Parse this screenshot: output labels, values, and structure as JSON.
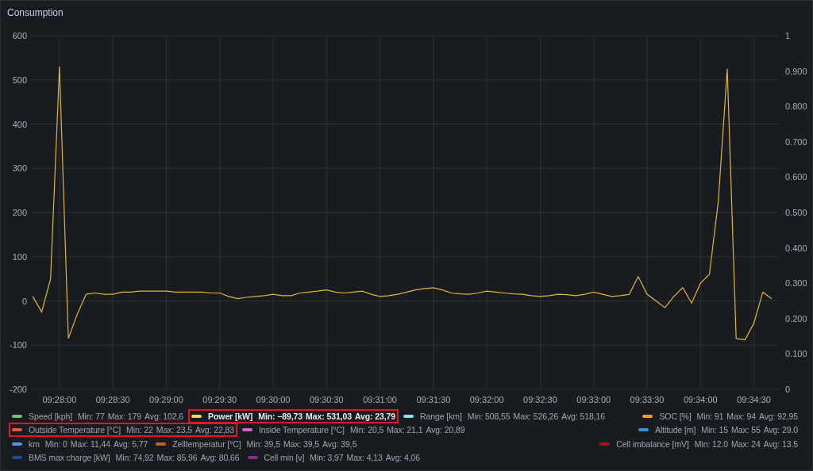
{
  "panel": {
    "title": "Consumption"
  },
  "chart_data": {
    "type": "line",
    "categories": [
      null,
      null,
      null,
      "09:28:00",
      null,
      null,
      null,
      null,
      null,
      "09:28:30",
      null,
      null,
      null,
      null,
      null,
      "09:29:00",
      null,
      null,
      null,
      null,
      null,
      "09:29:30",
      null,
      null,
      null,
      null,
      null,
      "09:30:00",
      null,
      null,
      null,
      null,
      null,
      "09:30:30",
      null,
      null,
      null,
      null,
      null,
      "09:31:00",
      null,
      null,
      null,
      null,
      null,
      "09:31:30",
      null,
      null,
      null,
      null,
      null,
      "09:32:00",
      null,
      null,
      null,
      null,
      null,
      "09:32:30",
      null,
      null,
      null,
      null,
      null,
      "09:33:00",
      null,
      null,
      null,
      null,
      null,
      "09:33:30",
      null,
      null,
      null,
      null,
      null,
      "09:34:00",
      null,
      null,
      null,
      null,
      null,
      "09:34:30",
      null,
      null
    ],
    "series": [
      {
        "color": "#e0b53a",
        "values": [
          10,
          -25,
          50,
          530,
          -85,
          -30,
          15,
          18,
          15,
          15,
          20,
          20,
          22,
          22,
          22,
          22,
          20,
          20,
          20,
          20,
          18,
          18,
          10,
          5,
          8,
          10,
          12,
          15,
          12,
          12,
          18,
          20,
          22,
          25,
          20,
          18,
          20,
          22,
          15,
          10,
          12,
          15,
          20,
          25,
          28,
          30,
          25,
          18,
          16,
          15,
          18,
          22,
          20,
          18,
          16,
          15,
          12,
          10,
          12,
          15,
          14,
          12,
          15,
          20,
          15,
          10,
          12,
          15,
          55,
          15,
          0,
          -15,
          10,
          30,
          -5,
          40,
          60,
          225,
          525,
          -85,
          -88,
          -50,
          20,
          5
        ]
      }
    ],
    "grid": true,
    "ylim": [
      -200,
      600
    ],
    "yticks": [
      600,
      500,
      400,
      300,
      200,
      100,
      0,
      -100,
      -200
    ]
  },
  "right_axis": {
    "ticks": [
      "1",
      "0.900",
      "0.800",
      "0.700",
      "0.600",
      "0.500",
      "0.400",
      "0.300",
      "0.200",
      "0.100",
      "0"
    ]
  },
  "legend": {
    "rows": [
      {
        "left": [
          {
            "name": "Speed [kph]",
            "color": "#73bf69",
            "min": "Min: 77",
            "max": "Max: 179",
            "avg": "Avg: 102,6",
            "selected": false,
            "highlighted": false
          },
          {
            "name": "Power [kW]",
            "color": "#fade2a",
            "min": "Min: −89,73",
            "max": "Max: 531,03",
            "avg": "Avg: 23,79",
            "selected": true,
            "highlighted": true
          },
          {
            "name": "Range [km]",
            "color": "#8ae1f5",
            "min": "Min: 508,55",
            "max": "Max: 526,26",
            "avg": "Avg: 518,16",
            "selected": false,
            "highlighted": false
          }
        ],
        "right": [
          {
            "name": "SOC [%]",
            "color": "#ff9830",
            "min": "Min: 91",
            "max": "Max: 94",
            "avg": "Avg: 92,95",
            "selected": false,
            "highlighted": false
          }
        ]
      },
      {
        "left": [
          {
            "name": "Outside Temperature [°C]",
            "color": "#e8573f",
            "min": "Min: 22",
            "max": "Max: 23,5",
            "avg": "Avg: 22,83",
            "selected": false,
            "highlighted": true
          },
          {
            "name": "Inside Temperature [°C]",
            "color": "#d066c4",
            "min": "Min: 20,5",
            "max": "Max: 21,1",
            "avg": "Avg: 20,89",
            "selected": false,
            "highlighted": false
          }
        ],
        "right": [
          {
            "name": "Altitude [m]",
            "color": "#3a8fd9",
            "min": "Min: 15",
            "max": "Max: 55",
            "avg": "Avg: 29.0",
            "selected": false,
            "highlighted": false
          }
        ]
      },
      {
        "left": [
          {
            "name": "km",
            "color": "#5794f2",
            "min": "Min: 0",
            "max": "Max: 11,44",
            "avg": "Avg: 5,77",
            "selected": false,
            "highlighted": false
          },
          {
            "name": "Zelltemperatur [°C]",
            "color": "#c4621c",
            "min": "Min: 39,5",
            "max": "Max: 39,5",
            "avg": "Avg: 39,5",
            "selected": false,
            "highlighted": false
          }
        ],
        "right": [
          {
            "name": "Cell imbalance [mV]",
            "color": "#a3170f",
            "min": "Min: 12.0",
            "max": "Max: 24",
            "avg": "Avg: 13.5",
            "selected": false,
            "highlighted": false
          }
        ]
      },
      {
        "left": [
          {
            "name": "BMS max charge [kW]",
            "color": "#1a4f9e",
            "min": "Min: 74,92",
            "max": "Max: 85,96",
            "avg": "Avg: 80,66",
            "selected": false,
            "highlighted": false
          },
          {
            "name": "Cell min [v]",
            "color": "#8f2a8f",
            "min": "Min: 3,97",
            "max": "Max: 4,13",
            "avg": "Avg: 4,06",
            "selected": false,
            "highlighted": false
          }
        ],
        "right": []
      }
    ]
  }
}
